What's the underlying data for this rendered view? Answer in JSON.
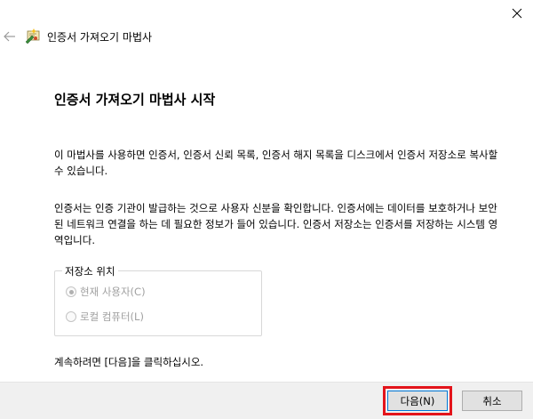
{
  "window": {
    "title": "인증서 가져오기 마법사",
    "close_icon": "close-icon",
    "back_icon": "back-arrow-icon",
    "wizard_icon": "certificate-wizard-icon"
  },
  "main": {
    "heading": "인증서 가져오기 마법사 시작",
    "paragraph1": "이 마법사를 사용하면 인증서, 인증서 신뢰 목록, 인증서 해지 목록을 디스크에서 인증서 저장소로 복사할 수 있습니다.",
    "paragraph2": "인증서는 인증 기관이 발급하는 것으로 사용자 신분을 확인합니다. 인증서에는 데이터를 보호하거나 보안된 네트워크 연결을 하는 데 필요한 정보가 들어 있습니다. 인증서 저장소는 인증서를 저장하는 시스템 영역입니다.",
    "store_location": {
      "legend": "저장소 위치",
      "options": [
        {
          "label": "현재 사용자(C)",
          "selected": true,
          "enabled": false
        },
        {
          "label": "로컬 컴퓨터(L)",
          "selected": false,
          "enabled": false
        }
      ]
    },
    "continue_text": "계속하려면 [다음]을 클릭하십시오."
  },
  "footer": {
    "next_label": "다음(N)",
    "cancel_label": "취소"
  },
  "colors": {
    "highlight": "#e3141b",
    "footer_bg": "#f0f0f0",
    "focus_border": "#0078d7"
  }
}
